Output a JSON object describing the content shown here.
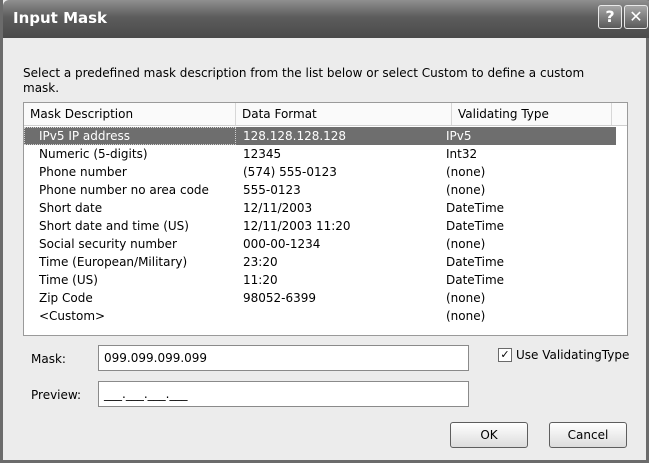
{
  "window": {
    "title": "Input Mask",
    "help_glyph": "?",
    "close_glyph": "✕"
  },
  "instructions": "Select a predefined mask description from the list below or select Custom to define a custom mask.",
  "list": {
    "headers": [
      "Mask Description",
      "Data Format",
      "Validating Type"
    ],
    "rows": [
      {
        "mask": "IPv5 IP address",
        "format": "128.128.128.128",
        "type": "IPv5"
      },
      {
        "mask": "Numeric (5-digits)",
        "format": "12345",
        "type": "Int32"
      },
      {
        "mask": "Phone number",
        "format": "(574) 555-0123",
        "type": "(none)"
      },
      {
        "mask": "Phone number no area code",
        "format": "555-0123",
        "type": "(none)"
      },
      {
        "mask": "Short date",
        "format": "12/11/2003",
        "type": "DateTime"
      },
      {
        "mask": "Short date and time (US)",
        "format": "12/11/2003 11:20",
        "type": "DateTime"
      },
      {
        "mask": "Social security number",
        "format": "000-00-1234",
        "type": "(none)"
      },
      {
        "mask": "Time (European/Military)",
        "format": "23:20",
        "type": "DateTime"
      },
      {
        "mask": "Time (US)",
        "format": "11:20",
        "type": "DateTime"
      },
      {
        "mask": "Zip Code",
        "format": "98052-6399",
        "type": "(none)"
      },
      {
        "mask": "<Custom>",
        "format": "",
        "type": "(none)"
      }
    ]
  },
  "mask_field": {
    "label": "Mask:",
    "value": "099.099.099.099"
  },
  "use_validating_type": {
    "label": "Use ValidatingType",
    "checked_glyph": "✓"
  },
  "preview_field": {
    "label": "Preview:",
    "value": "___.___.___.___"
  },
  "buttons": {
    "ok": "OK",
    "cancel": "Cancel"
  }
}
